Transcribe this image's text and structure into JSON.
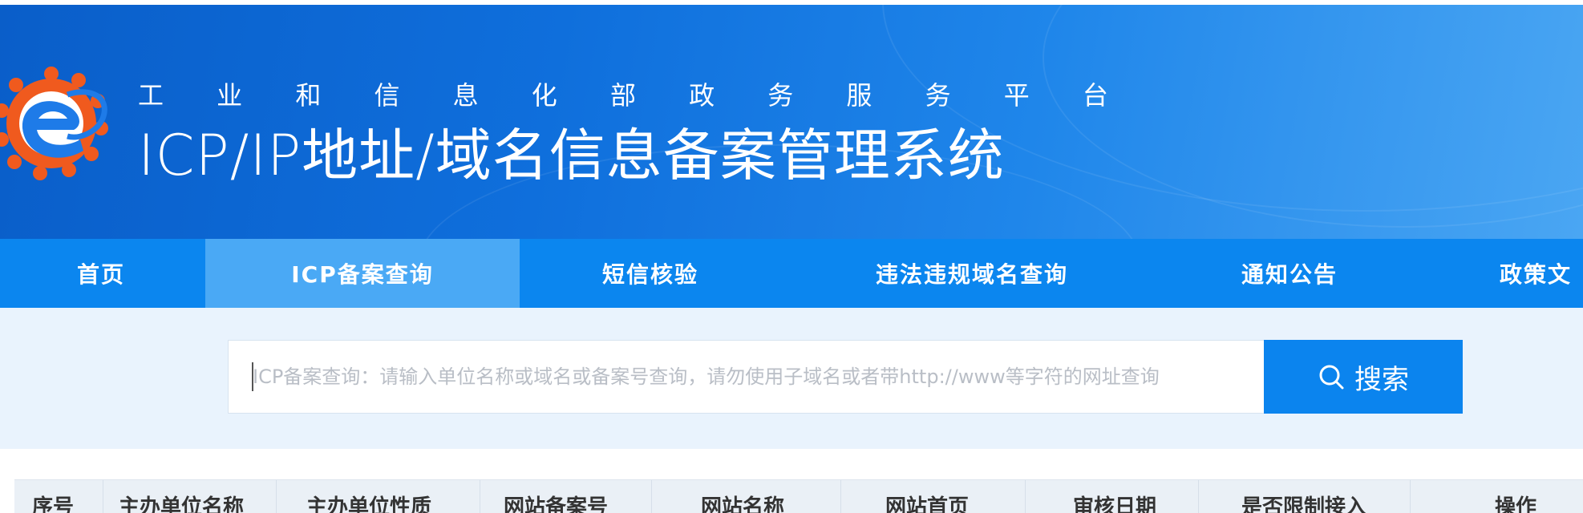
{
  "header": {
    "subtitle_chars": [
      "工",
      "业",
      "和",
      "信",
      "息",
      "化",
      "部",
      "政",
      "务",
      "服",
      "务",
      "平",
      "台"
    ],
    "title": "ICP/IP地址/域名信息备案管理系统",
    "colors": {
      "header_blue": "#0f6fdc",
      "logo_orange": "#f05a1e",
      "logo_blue": "#1e7be8"
    },
    "logo_icon": "miit-gear-e-logo"
  },
  "nav": {
    "items": [
      {
        "label": "首页",
        "active": false
      },
      {
        "label": "ICP备案查询",
        "active": true
      },
      {
        "label": "短信核验",
        "active": false
      },
      {
        "label": "违法违规域名查询",
        "active": false
      },
      {
        "label": "通知公告",
        "active": false
      },
      {
        "label": "政策文",
        "active": false
      }
    ],
    "colors": {
      "bar": "#0b86ef",
      "active": "#4aa9f5"
    }
  },
  "search": {
    "placeholder": "ICP备案查询：请输入单位名称或域名或备案号查询，请勿使用子域名或者带http://www等字符的网址查询",
    "value": "",
    "button_label": "搜索",
    "button_icon": "search-icon",
    "colors": {
      "button": "#0b84ee",
      "background": "#e9f3fd"
    }
  },
  "table": {
    "columns": [
      "序号",
      "主办单位名称",
      "主办单位性质",
      "网站备案号",
      "网站名称",
      "网站首页",
      "审核日期",
      "是否限制接入",
      "操作"
    ]
  }
}
